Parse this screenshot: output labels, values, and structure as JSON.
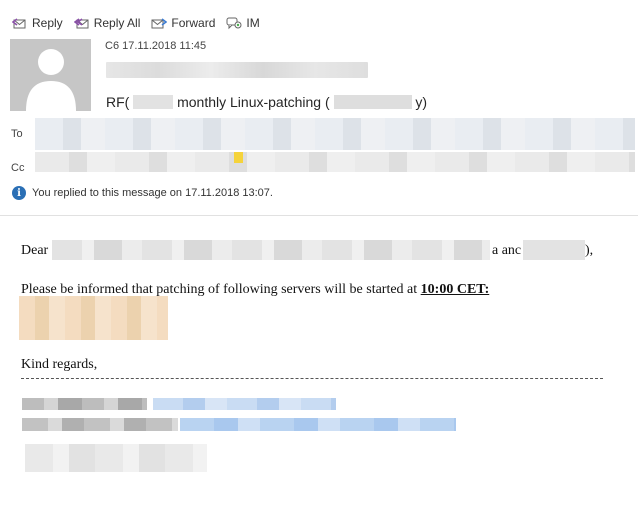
{
  "toolbar": {
    "reply_label": "Reply",
    "reply_all_label": "Reply All",
    "forward_label": "Forward",
    "im_label": "IM"
  },
  "header": {
    "sent_prefix": "C6",
    "sent_datetime": "17.11.2018 11:45",
    "subject_prefix": "RF(",
    "subject_main": "monthly Linux-patching (",
    "subject_suffix": "y)",
    "to_label": "To",
    "cc_label": "Cc",
    "info_text": "You replied to this message on 17.11.2018 13:07."
  },
  "message": {
    "greeting_start": "Dear",
    "greeting_mid": "a anc",
    "greeting_end": "),",
    "notice_text": "Please be informed that patching of following servers will be started at",
    "notice_time": "10:00 CET:",
    "closing": "Kind regards,"
  },
  "colors": {
    "info_icon": "#2a6fb5",
    "highlight_yellow": "#f5d33b",
    "signature_blue": "#b9d3f1",
    "server_list_tan": "#f1d9b8"
  }
}
